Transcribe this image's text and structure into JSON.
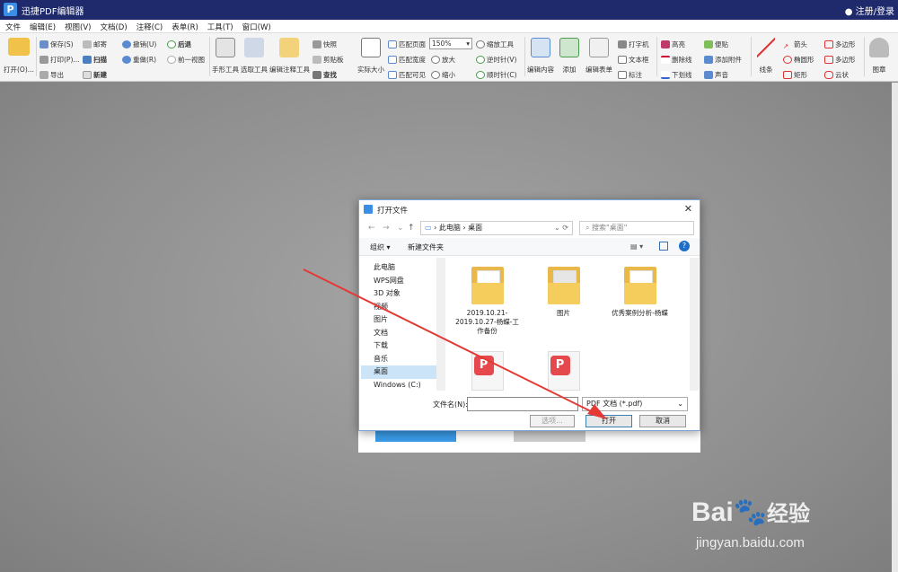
{
  "app": {
    "title": "迅捷PDF编辑器",
    "user_link": "注册/登录"
  },
  "menu": [
    "文件",
    "编辑(E)",
    "视图(V)",
    "文档(D)",
    "注释(C)",
    "表单(R)",
    "工具(T)",
    "窗口(W)"
  ],
  "toolbar": {
    "open": "打开(O)...",
    "save": "保存(S)",
    "print": "打印(P)...",
    "export": "导出",
    "mail": "邮寄",
    "scan": "扫描",
    "new": "新建",
    "undo": "撤销(U)",
    "redo": "重做(R)",
    "back": "后退",
    "forward": "前一视图",
    "hand": "手形工具",
    "select": "选取工具",
    "edit_annot": "编辑注释工具",
    "snapshot": "快照",
    "clipboard": "剪贴板",
    "find": "查找",
    "actual_size": "实际大小",
    "fit_page": "匹配页面",
    "fit_width": "匹配宽度",
    "fit_visible": "匹配可见",
    "zoom_value": "150%",
    "zoom_tool": "缩放工具",
    "zoom_in": "放大",
    "zoom_out": "缩小",
    "rotate_ccw": "逆时针(V)",
    "rotate_cw": "顺时针(C)",
    "edit_content": "编辑内容",
    "add": "添加",
    "edit_form": "编辑表单",
    "typewriter": "打字机",
    "textbox": "文本框",
    "callout": "标注",
    "highlight": "高亮",
    "strikethrough": "删除线",
    "underline": "下划线",
    "note": "便贴",
    "attach": "添加附件",
    "sound": "声音",
    "line": "线条",
    "arrow": "箭头",
    "ellipse": "椭圆形",
    "rect": "矩形",
    "polygon": "多边形",
    "polyline": "多边形",
    "cloud": "云状",
    "stamp": "图章"
  },
  "dialog": {
    "title": "打开文件",
    "path": [
      "此电脑",
      "桌面"
    ],
    "search_placeholder": "搜索\"桌面\"",
    "organize": "组织",
    "new_folder": "新建文件夹",
    "tree": [
      "此电脑",
      "WPS网盘",
      "3D 对象",
      "视频",
      "图片",
      "文档",
      "下载",
      "音乐",
      "桌面",
      "Windows (C:)"
    ],
    "files": [
      {
        "name": "2019.10.21-2019.10.27-杨蝶-工作备份",
        "kind": "folder"
      },
      {
        "name": "图片",
        "kind": "folder"
      },
      {
        "name": "优秀案例分析-杨蝶",
        "kind": "folder"
      },
      {
        "name": "",
        "kind": "pdf"
      },
      {
        "name": "",
        "kind": "pdf"
      }
    ],
    "filename_label": "文件名(N):",
    "filename_value": "",
    "filetype": "PDF 文档 (*.pdf)",
    "select_btn": "选项...",
    "open_btn": "打开",
    "cancel_btn": "取消"
  },
  "watermark": {
    "brand": "Bai",
    "brand2": "经验",
    "url": "jingyan.baidu.com"
  },
  "colors": {
    "titlebar": "#1e2a6b",
    "accent": "#3a8ee6",
    "arrow": "#e53935"
  }
}
